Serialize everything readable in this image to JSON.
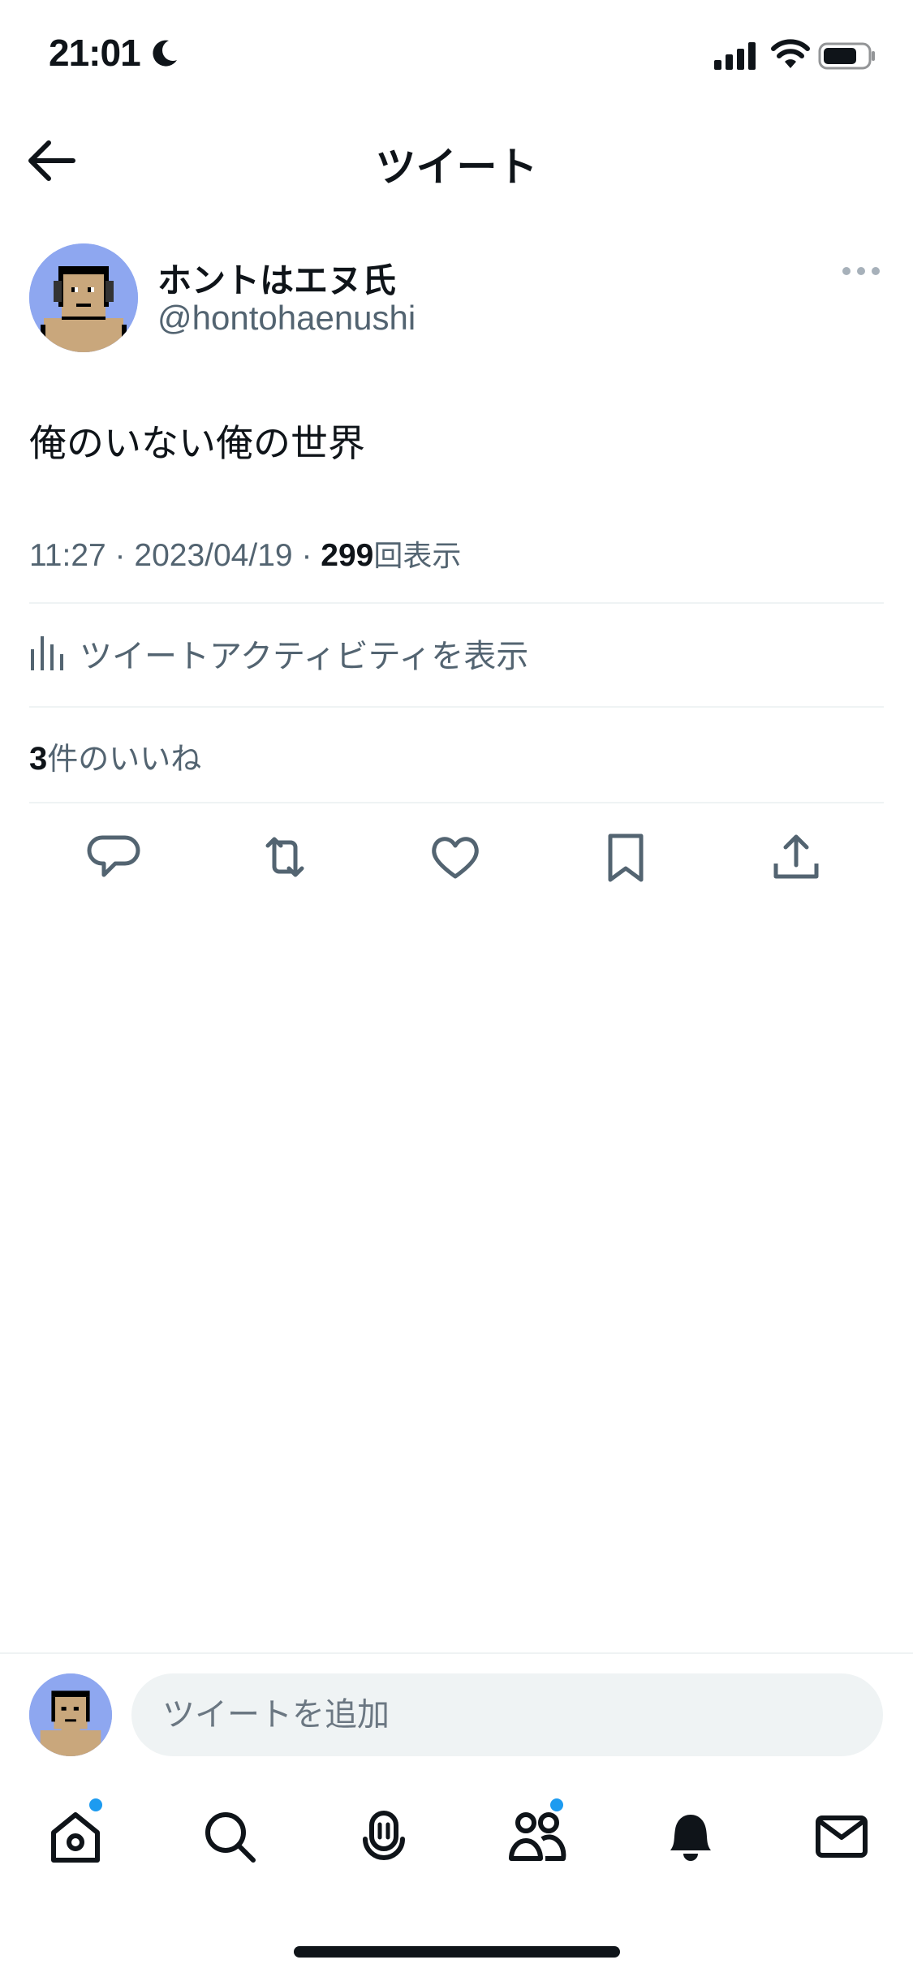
{
  "status_bar": {
    "time": "21:01",
    "icons": [
      "moon-icon",
      "signal-icon",
      "wifi-icon",
      "battery-icon"
    ]
  },
  "header": {
    "title": "ツイート",
    "back_icon": "arrow-left-icon"
  },
  "tweet": {
    "author_name": "ホントはエヌ氏",
    "author_handle": "@hontohaenushi",
    "text": "俺のいない俺の世界",
    "time": "11:27",
    "separator": "·",
    "date": "2023/04/19",
    "views_count": "299",
    "views_label": "回表示",
    "activity_label": "ツイートアクティビティを表示",
    "likes_count": "3",
    "likes_label": "件のいいね"
  },
  "actions": [
    "reply-icon",
    "retweet-icon",
    "like-icon",
    "bookmark-icon",
    "share-icon"
  ],
  "reply_bar": {
    "placeholder": "ツイートを追加"
  },
  "bottom_nav": [
    {
      "name": "home",
      "badge": true
    },
    {
      "name": "search",
      "badge": false
    },
    {
      "name": "spaces",
      "badge": false
    },
    {
      "name": "communities",
      "badge": true
    },
    {
      "name": "notifications",
      "badge": false
    },
    {
      "name": "messages",
      "badge": false
    }
  ],
  "colors": {
    "text_primary": "#0f1419",
    "text_secondary": "#536471",
    "divider": "#eff3f4",
    "accent": "#1d9bf0",
    "avatar_bg": "#8ea7f0"
  }
}
